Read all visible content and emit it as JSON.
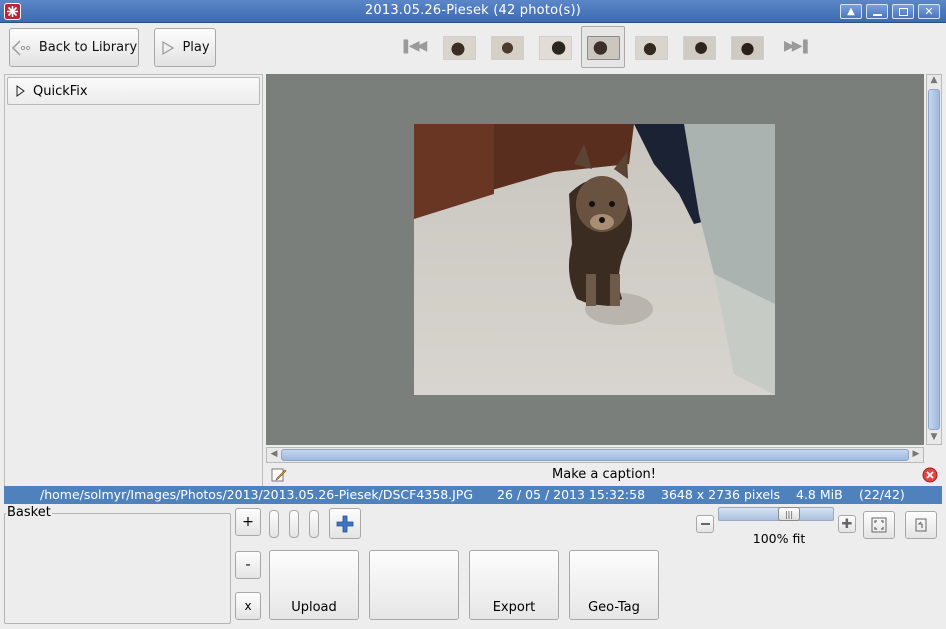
{
  "window": {
    "title": "2013.05.26-Piesek (42 photo(s))",
    "controls": [
      "up-icon",
      "minimize-icon",
      "maximize-icon",
      "close-icon"
    ]
  },
  "toolbar": {
    "back_label": "Back to Library",
    "play_label": "Play",
    "thumbnail_count": 7,
    "selected_thumbnail_index": 3
  },
  "left_panel": {
    "quickfix_label": "QuickFix"
  },
  "caption": {
    "text": "Make a caption!"
  },
  "status": {
    "path": "/home/solmyr/Images/Photos/2013/2013.05.26-Piesek/DSCF4358.JPG",
    "datetime": "26 / 05 / 2013 15:32:58",
    "dimensions": "3648 x 2736 pixels",
    "size": "4.8 MiB",
    "position": "(22/42)"
  },
  "basket": {
    "label": "Basket",
    "add_label": "+",
    "remove_label": "-",
    "clear_label": "x"
  },
  "actions": {
    "upload_label": "Upload",
    "blank_label": "",
    "export_label": "Export",
    "geotag_label": "Geo-Tag"
  },
  "zoom": {
    "label": "100% fit",
    "slider_fraction": 0.64
  },
  "colors": {
    "titlebar": "#4a77bc",
    "statusbar": "#4f82bd",
    "viewer_bg": "#7b7f7b"
  }
}
